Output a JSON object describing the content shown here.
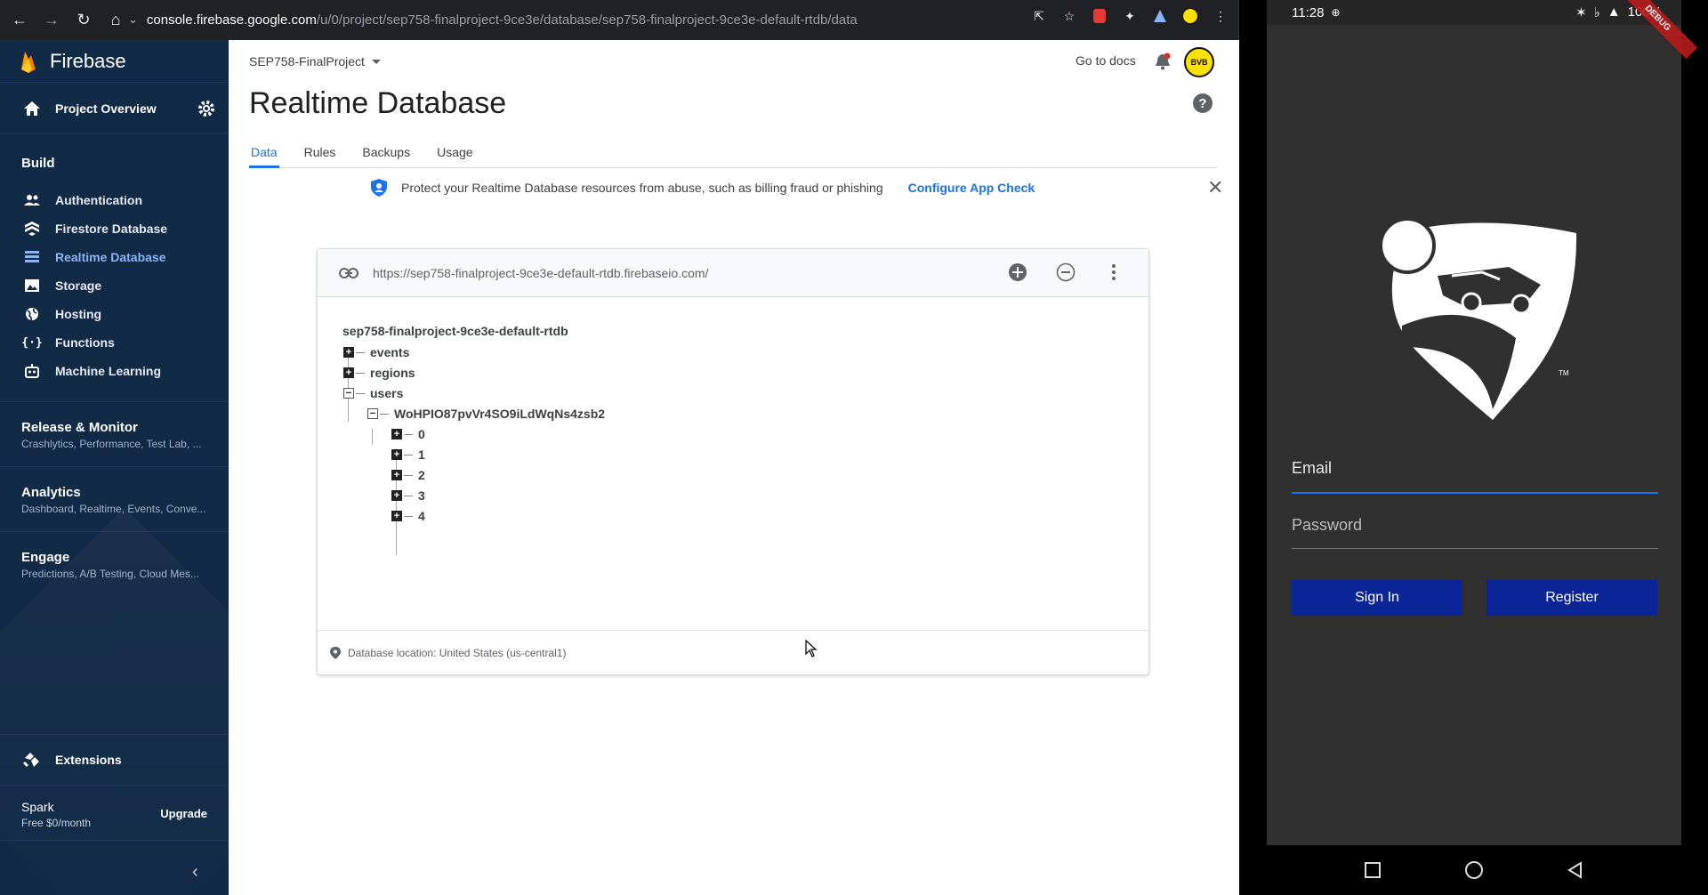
{
  "browser": {
    "url_host": "console.firebase.google.com",
    "url_path": "/u/0/project/sep758-finalproject-9ce3e/database/sep758-finalproject-9ce3e-default-rtdb/data"
  },
  "sidebar": {
    "brand": "Firebase",
    "project_overview": "Project Overview",
    "build_title": "Build",
    "build_items": [
      {
        "label": "Authentication",
        "icon": "people-icon"
      },
      {
        "label": "Firestore Database",
        "icon": "firestore-icon"
      },
      {
        "label": "Realtime Database",
        "icon": "database-icon",
        "active": true
      },
      {
        "label": "Storage",
        "icon": "image-icon"
      },
      {
        "label": "Hosting",
        "icon": "globe-icon"
      },
      {
        "label": "Functions",
        "icon": "functions-icon"
      },
      {
        "label": "Machine Learning",
        "icon": "robot-icon"
      }
    ],
    "groups": [
      {
        "title": "Release & Monitor",
        "sub": "Crashlytics, Performance, Test Lab, ..."
      },
      {
        "title": "Analytics",
        "sub": "Dashboard, Realtime, Events, Conve..."
      },
      {
        "title": "Engage",
        "sub": "Predictions, A/B Testing, Cloud Mes..."
      }
    ],
    "extensions": "Extensions",
    "plan_name": "Spark",
    "plan_price": "Free $0/month",
    "upgrade": "Upgrade"
  },
  "header": {
    "project": "SEP758-FinalProject",
    "docs": "Go to docs",
    "avatar": "BVB",
    "title": "Realtime Database"
  },
  "tabs": [
    "Data",
    "Rules",
    "Backups",
    "Usage"
  ],
  "banner": {
    "text": "Protect your Realtime Database resources from abuse, such as billing fraud or phishing",
    "link": "Configure App Check"
  },
  "db": {
    "url": "https://sep758-finalproject-9ce3e-default-rtdb.firebaseio.com/",
    "root": "sep758-finalproject-9ce3e-default-rtdb",
    "children": [
      "events",
      "regions",
      "users"
    ],
    "user_key": "WoHPIO87pvVr4SO9iLdWqNs4zsb2",
    "user_children": [
      "0",
      "1",
      "2",
      "3",
      "4"
    ],
    "location": "Database location: United States (us-central1)"
  },
  "phone": {
    "time": "11:28",
    "battery": "100%",
    "debug": "DEBUG",
    "tm": "TM",
    "email_label": "Email",
    "password_label": "Password",
    "sign_in": "Sign In",
    "register": "Register"
  }
}
